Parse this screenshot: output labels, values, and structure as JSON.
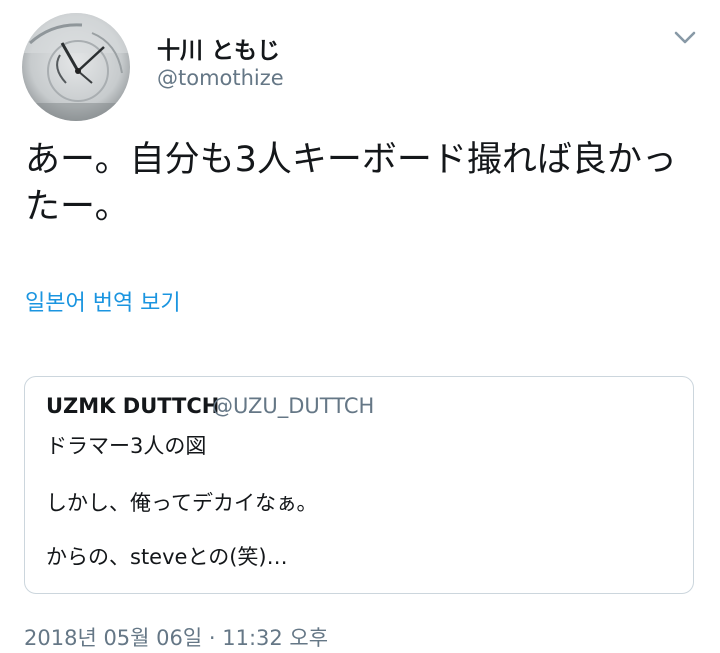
{
  "author": {
    "display_name": "十川 ともじ",
    "handle": "@tomothize",
    "avatar_icon": "clock-avatar"
  },
  "menu_icon": "chevron-down-icon",
  "tweet": {
    "text": "あー。自分も3人キーボード撮れば良かったー。",
    "translate_label": "일본어 번역 보기",
    "timestamp": "2018년 05월 06일 · 11:32 오후"
  },
  "quoted_tweet": {
    "display_name": "UZMK DUTTCH",
    "handle": "@UZU_DUTTCH",
    "lines": [
      "ドラマー3人の図",
      "しかし、俺ってデカイなぁ。",
      "からの、steveとの(笑)…"
    ]
  },
  "colors": {
    "link": "#1b95e0",
    "secondary_text": "#657786",
    "primary_text": "#14171a",
    "border": "#ccd6dd"
  }
}
